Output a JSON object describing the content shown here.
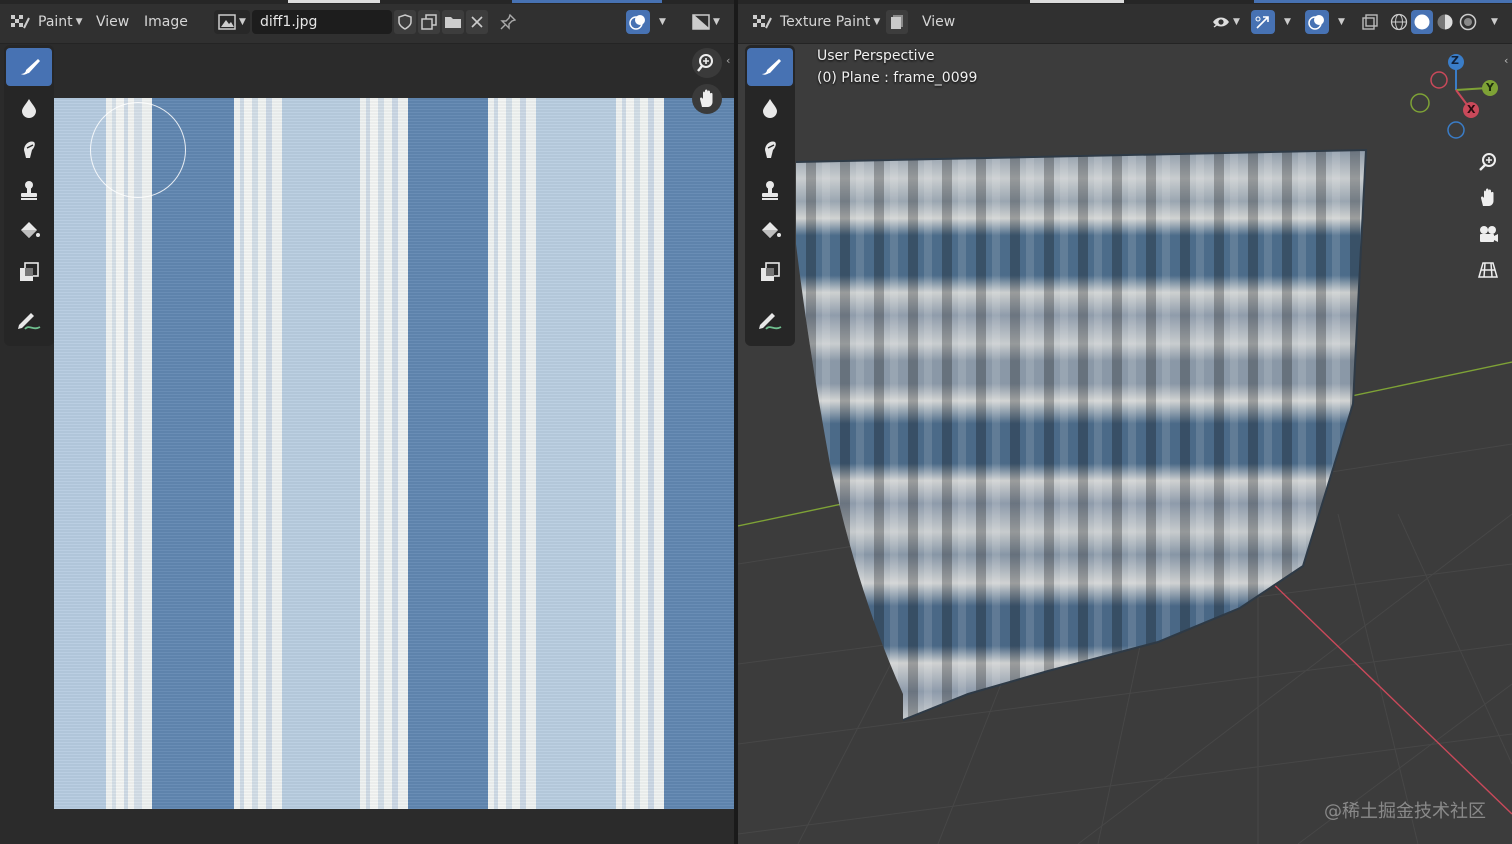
{
  "image_editor": {
    "mode_label": "Paint",
    "menus": [
      "View",
      "Image"
    ],
    "image_name": "diff1.jpg"
  },
  "viewport": {
    "mode_label": "Texture Paint",
    "menus": [
      "View"
    ],
    "overlay_line1": "User Perspective",
    "overlay_line2": "(0) Plane : frame_0099"
  },
  "gizmo": {
    "x": "X",
    "y": "Y",
    "z": "Z"
  },
  "watermark": "@稀土掘金技术社区",
  "tools": [
    "draw-brush",
    "soften-brush",
    "smear-brush",
    "clone-brush",
    "fill-brush",
    "mask-brush",
    "annotate"
  ],
  "colors": {
    "active_tool": "#4772b3",
    "stripe_dark": "#5f86b0",
    "stripe_light": "#b9cde0",
    "stripe_white": "#eef2f1",
    "axis_x": "#c9495a",
    "axis_y": "#7ea236",
    "axis_z": "#3a7dc8"
  }
}
